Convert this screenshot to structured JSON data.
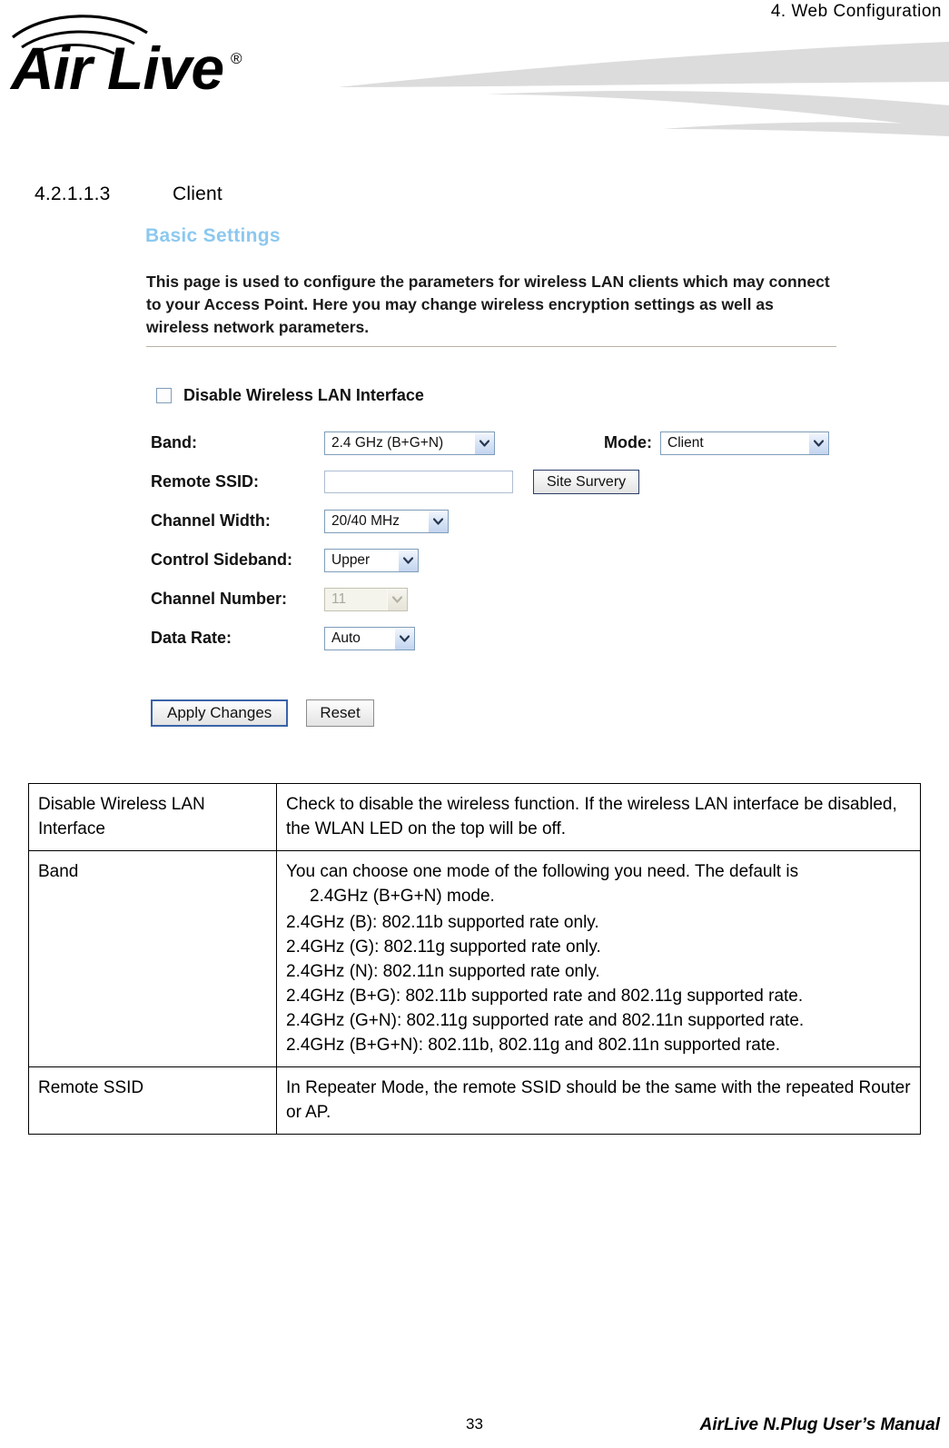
{
  "header": {
    "running_title": "4. Web Configuration",
    "logo_text": "Air Live",
    "logo_registered": "®"
  },
  "section": {
    "number": "4.2.1.1.3",
    "title": "Client"
  },
  "webui": {
    "panel_title": "Basic Settings",
    "description": "This page is used to configure the parameters for wireless LAN clients which may connect to your Access Point. Here you may change wireless encryption settings as well as wireless network parameters.",
    "disable_checkbox_label": "Disable Wireless LAN Interface",
    "disable_checkbox_checked": false,
    "fields": {
      "band_label": "Band:",
      "band_value": "2.4 GHz (B+G+N)",
      "mode_label": "Mode:",
      "mode_value": "Client",
      "remote_ssid_label": "Remote  SSID:",
      "remote_ssid_value": "",
      "site_survey_button": "Site Survery",
      "channel_width_label": "Channel Width:",
      "channel_width_value": "20/40 MHz",
      "control_sideband_label": "Control  Sideband:",
      "control_sideband_value": "Upper",
      "channel_number_label": "Channel Number:",
      "channel_number_value": "11",
      "channel_number_disabled": true,
      "data_rate_label": "Data Rate:",
      "data_rate_value": "Auto"
    },
    "buttons": {
      "apply": "Apply Changes",
      "reset": "Reset"
    }
  },
  "table": {
    "rows": [
      {
        "term": "Disable Wireless LAN Interface",
        "description": "Check to disable the wireless function. If the wireless LAN interface be disabled, the WLAN LED on the top will be off."
      },
      {
        "term": "Band",
        "intro": "You can choose one mode of the following you need. The default is",
        "default_mode": "2.4GHz (B+G+N) mode.",
        "modes": [
          "2.4GHz (B): 802.11b supported rate only.",
          "2.4GHz (G): 802.11g supported rate only.",
          "2.4GHz (N): 802.11n supported rate only.",
          "2.4GHz (B+G): 802.11b supported rate and 802.11g supported rate.",
          "2.4GHz (G+N): 802.11g supported rate and 802.11n supported rate.",
          "2.4GHz (B+G+N): 802.11b, 802.11g and 802.11n supported rate."
        ]
      },
      {
        "term": "Remote SSID",
        "description": "In Repeater Mode, the remote SSID should be the same with the repeated Router or AP."
      }
    ]
  },
  "footer": {
    "page_number": "33",
    "manual_title": "AirLive N.Plug User’s Manual"
  },
  "colors": {
    "panel_title": "#8cc8ef",
    "swoosh": "#dcdcdc",
    "select_border": "#7f9db9"
  }
}
